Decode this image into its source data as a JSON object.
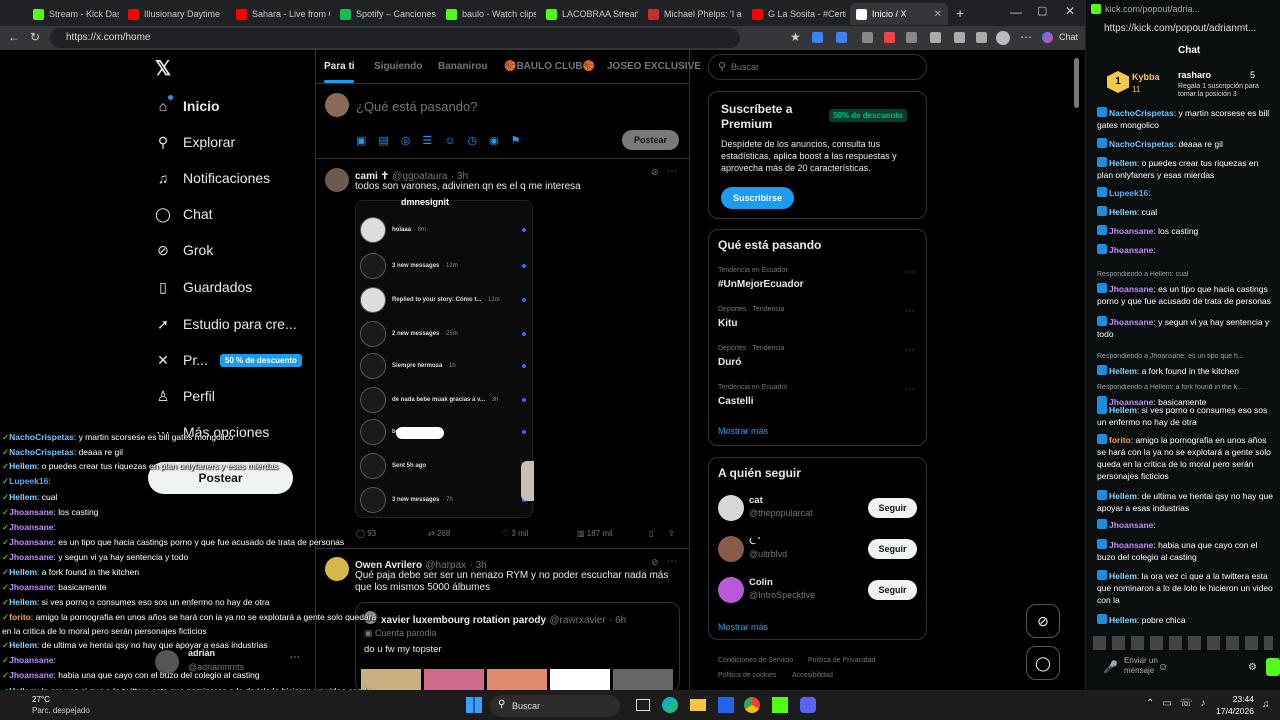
{
  "browser": {
    "tabs": [
      {
        "label": "Stream - Kick Dashb",
        "color": "#53fc18"
      },
      {
        "label": "Illusionary Daytime",
        "color": "#ff0000"
      },
      {
        "label": "Sahara - Live from C",
        "color": "#ff0000"
      },
      {
        "label": "Spotify – Canciones",
        "color": "#1db954"
      },
      {
        "label": "baulo - Watch clips",
        "color": "#53fc18"
      },
      {
        "label": "LACOBRAA Stream",
        "color": "#53fc18"
      },
      {
        "label": "Michael Phelps: 'I an",
        "color": "#c4302b"
      },
      {
        "label": "G La Sosita - #Certif",
        "color": "#ff0000"
      },
      {
        "label": "Inicio / X",
        "color": "#ffffff"
      }
    ],
    "url": "https://x.com/home"
  },
  "x": {
    "nav": [
      {
        "label": "Inicio",
        "icon": "home-icon",
        "glyph": "⌂"
      },
      {
        "label": "Explorar",
        "icon": "search-icon",
        "glyph": "⚲"
      },
      {
        "label": "Notificaciones",
        "icon": "bell-icon",
        "glyph": "♫"
      },
      {
        "label": "Chat",
        "icon": "chat-icon",
        "glyph": "◯"
      },
      {
        "label": "Grok",
        "icon": "grok-icon",
        "glyph": "⊘"
      },
      {
        "label": "Guardados",
        "icon": "bookmark-icon",
        "glyph": "▯"
      },
      {
        "label": "Estudio para cre...",
        "icon": "rocket-icon",
        "glyph": "➚"
      },
      {
        "label": "Pr...",
        "icon": "x-premium-icon",
        "glyph": "✕"
      },
      {
        "label": "Perfil",
        "icon": "person-icon",
        "glyph": "♙"
      },
      {
        "label": "Más opciones",
        "icon": "more-icon",
        "glyph": "⋯"
      }
    ],
    "premium_badge": "50 % de descuento",
    "post_button": "Postear",
    "account": {
      "name": "adrian",
      "handle": "@adrianmmts"
    },
    "timeline_tabs": [
      "Para ti",
      "Siguiendo",
      "Bananirou",
      "🏀BAULO CLUB🏀",
      "JOSEO EXCLUSIVE"
    ],
    "composer_placeholder": "¿Qué está pasando?",
    "composer_post": "Postear",
    "tweet1": {
      "name": "cami ✝",
      "handle": "@ggoataura",
      "time": "· 3h",
      "text": "todos son varones, adivinen qn es el q me interesa",
      "phone_header": "dmnesignit",
      "dms": [
        {
          "name": "holaaa",
          "meta": "· 8m",
          "white": true
        },
        {
          "name": "3 new messages",
          "meta": "· 12m",
          "white": false
        },
        {
          "name": "Replied to your story: Cómo t...",
          "meta": "· 12m",
          "white": true
        },
        {
          "name": "2 new messages",
          "meta": "· 25m",
          "white": false
        },
        {
          "name": "Siempre hermosa",
          "meta": "· 1h",
          "white": false
        },
        {
          "name": "de nada bebe muak gracias a v...",
          "meta": "· 3h",
          "white": false
        },
        {
          "name": "bonita :3",
          "meta": "· 4h",
          "white": false
        },
        {
          "name": "Sent 5h ago",
          "meta": "",
          "white": false
        },
        {
          "name": "3 new messages",
          "meta": "· 7h",
          "white": false
        }
      ],
      "replies": "93",
      "reposts": "268",
      "likes": "3 mil",
      "views": "187 mil"
    },
    "tweet2": {
      "name": "Owen Avrilero",
      "handle": "@harpax",
      "time": "· 3h",
      "text": "Qué paja debe ser ser un nenazo RYM y no poder escuchar nada más que los mismos 5000 álbumes",
      "quote_name": "xavier luxembourg rotation parody",
      "quote_handle": "@rawrxavier",
      "quote_time": "· 6h",
      "quote_tag": "Cuenta parodia",
      "quote_text": "do u fw my topster"
    },
    "search_placeholder": "Buscar",
    "premium": {
      "title": "Suscríbete a Premium",
      "discount": "50% de descuento",
      "desc": "Despídete de los anuncios, consulta tus estadísticas, aplica boost a las respuestas y aprovecha más de 20 características.",
      "cta": "Suscribirse"
    },
    "trends_title": "Qué está pasando",
    "trends": [
      {
        "meta": "Tendencia en Ecuador",
        "name": "#UnMejorEcuador"
      },
      {
        "meta": "Deportes · Tendencia",
        "name": "Kitu"
      },
      {
        "meta": "Deportes · Tendencia",
        "name": "Duró"
      },
      {
        "meta": "Tendencia en Ecuador",
        "name": "Castelli"
      }
    ],
    "show_more": "Mostrar más",
    "follow_title": "A quién seguir",
    "follow": [
      {
        "name": "cat",
        "handle": "@thepopularcat",
        "color": "#d8d8d8"
      },
      {
        "name": "⏾ ̊",
        "handle": "@ultrblvd",
        "color": "#8a5a4a"
      },
      {
        "name": "Colin",
        "handle": "@IntroSpecktive",
        "color": "#b85ad8"
      }
    ],
    "follow_btn": "Seguir",
    "show_more2": "Mostrar más",
    "footer": [
      "Condiciones de Servicio",
      "Política de Privacidad",
      "Política de cookies",
      "Accesibilidad"
    ]
  },
  "overlay_chat": [
    {
      "user": "NachoCrispetas",
      "color": "#6ec6ff",
      "msg": ": y martin scorsese es bill gates mongolico"
    },
    {
      "user": "NachoCrispetas",
      "color": "#6ec6ff",
      "msg": ": deaaa re gil"
    },
    {
      "user": "Hellem",
      "color": "#7cd6ff",
      "msg": ": o puedes crear tus riquezas en plan onlyfaners y esas mierdas"
    },
    {
      "user": "Lupeek16",
      "color": "#5aa9ff",
      "msg": ":"
    },
    {
      "user": "Hellem",
      "color": "#7cd6ff",
      "msg": ": cual"
    },
    {
      "user": "Jhoansane",
      "color": "#c08cff",
      "msg": ": los casting"
    },
    {
      "user": "Jhoansane",
      "color": "#c08cff",
      "msg": ":"
    },
    {
      "user": "Jhoansane",
      "color": "#c08cff",
      "msg": ": es un tipo que hacia castings porno y que fue acusado de trata de personas"
    },
    {
      "user": "Jhoansane",
      "color": "#c08cff",
      "msg": ": y segun vi ya hay sentencia y todo"
    },
    {
      "user": "Hellem",
      "color": "#7cd6ff",
      "msg": ": a fork found in the kitchen"
    },
    {
      "user": "Jhoansane",
      "color": "#c08cff",
      "msg": ": basicamente"
    },
    {
      "user": "Hellem",
      "color": "#7cd6ff",
      "msg": ": si ves porno o consumes eso sos un enfermo no hay de otra"
    },
    {
      "user": "forito",
      "color": "#f0a04b",
      "msg": ": amigo la pornografia en unos años se hará con ia ya no se explotará a gente solo quedará"
    },
    {
      "user": "",
      "color": "#ffffff",
      "msg": "en la critica de lo moral pero serán personajes ficticios"
    },
    {
      "user": "Hellem",
      "color": "#7cd6ff",
      "msg": ": de ultima ve hentai qsy no hay que apoyar a esas industrias"
    },
    {
      "user": "Jhoansane",
      "color": "#c08cff",
      "msg": ":"
    },
    {
      "user": "Jhoansane",
      "color": "#c08cff",
      "msg": ": habia una que cayo con el buzo del colegio al casting"
    },
    {
      "user": "Hellem",
      "color": "#7cd6ff",
      "msg": ": la ora vez ci que a la twittera esta que nominaron a lo de lolo le hicieron un video con la"
    },
    {
      "user": "Hellem",
      "color": "#7cd6ff",
      "msg": ": pobre chica"
    }
  ],
  "kick": {
    "url_top": "kick.com/popout/adria...",
    "url": "https://kick.com/popout/adrianmt...",
    "chat_title": "Chat",
    "top_user": "Kybba",
    "top_count": "11",
    "sub_user": "rasharo",
    "sub_count": "5",
    "sub_text": "Regala 1 suscripción para tomar la posición 3",
    "messages": [
      {
        "user": "NachoCrispetas",
        "color": "#6ec6ff",
        "msg": ": y martin scorsese es bill gates mongolico",
        "reply": ""
      },
      {
        "user": "NachoCrispetas",
        "color": "#6ec6ff",
        "msg": ": deaaa re gil",
        "reply": ""
      },
      {
        "user": "Hellem",
        "color": "#7cd6ff",
        "msg": ": o puedes crear tus riquezas en plan onlyfaners y esas mierdas",
        "reply": ""
      },
      {
        "user": "Lupeek16",
        "color": "#5aa9ff",
        "msg": ":",
        "reply": ""
      },
      {
        "user": "Hellem",
        "color": "#7cd6ff",
        "msg": ": cual",
        "reply": ""
      },
      {
        "user": "Jhoansane",
        "color": "#c08cff",
        "msg": ": los casting",
        "reply": ""
      },
      {
        "user": "Jhoansane",
        "color": "#c08cff",
        "msg": ":",
        "reply": ""
      },
      {
        "user": "Jhoansane",
        "color": "#c08cff",
        "msg": ": es un tipo que hacia castings porno y que fue acusado de trata de personas",
        "reply": "Respondiendo a Hellem: cual"
      },
      {
        "user": "Jhoansane",
        "color": "#c08cff",
        "msg": ": y segun vi ya hay sentencia y todo",
        "reply": ""
      },
      {
        "user": "Hellem",
        "color": "#7cd6ff",
        "msg": ": a fork found in the kitchen",
        "reply": "Respondiendo a Jhoansane: es un tipo que h..."
      },
      {
        "user": "Jhoansane",
        "color": "#c08cff",
        "msg": ": basicamente",
        "reply": "Respondiendo a Hellem: a fork found in the k..."
      },
      {
        "user": "Hellem",
        "color": "#7cd6ff",
        "msg": ": si ves porno o consumes eso sos un enfermo no hay de otra",
        "reply": ""
      },
      {
        "user": "forito",
        "color": "#f0a04b",
        "msg": ": amigo la pornografia en unos años se hará con la ya no se explotará a gente solo queda en la critica de lo moral pero serán personajes ficticios",
        "reply": ""
      },
      {
        "user": "Hellem",
        "color": "#7cd6ff",
        "msg": ": de ultima ve hentai qsy no hay que apoyar a esas industrias",
        "reply": ""
      },
      {
        "user": "Jhoansane",
        "color": "#c08cff",
        "msg": ":",
        "reply": ""
      },
      {
        "user": "Jhoansane",
        "color": "#c08cff",
        "msg": ": habia una que cayo con el buzo del colegio al casting",
        "reply": ""
      },
      {
        "user": "Hellem",
        "color": "#7cd6ff",
        "msg": ": la ora vez ci que a la twittera esta que nominaron a lo de lolo le hicieron un video con la",
        "reply": ""
      },
      {
        "user": "Hellem",
        "color": "#7cd6ff",
        "msg": ": pobre chica",
        "reply": ""
      }
    ],
    "send_placeholder": "Enviar un mensaje"
  },
  "taskbar": {
    "weather": "27°C",
    "weather_desc": "Parc. despejado",
    "search": "Buscar",
    "time": "23:44",
    "date": "17/4/2026"
  }
}
